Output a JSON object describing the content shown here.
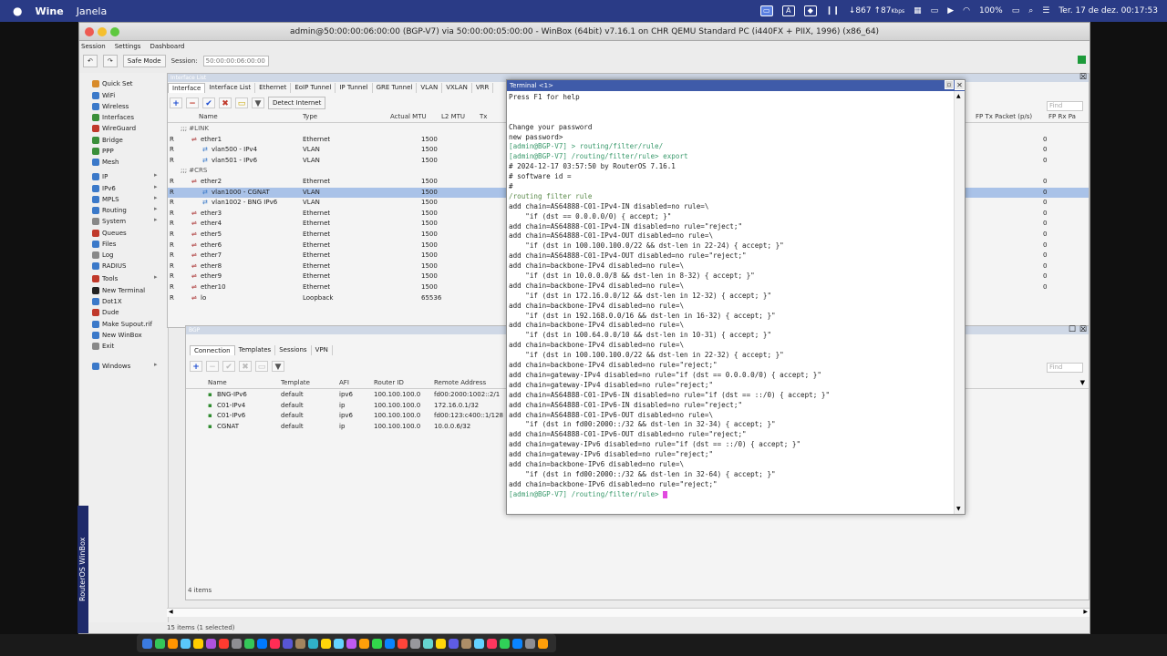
{
  "menubar": {
    "apple": "",
    "app": "Wine",
    "menu_window": "Janela",
    "network": "↓867 ↑87",
    "network_unit": "Kbps",
    "battery": "100%",
    "datetime": "Ter. 17 de dez.  00:17:53"
  },
  "window": {
    "title": "admin@50:00:00:06:00:00 (BGP-V7) via 50:00:00:05:00:00 - WinBox (64bit) v7.16.1 on CHR QEMU Standard PC (i440FX + PIIX, 1996) (x86_64)",
    "menu": [
      "Session",
      "Settings",
      "Dashboard"
    ],
    "safe_mode": "Safe Mode",
    "session_label": "Session:",
    "session_value": "50:00:00:06:00:00"
  },
  "sidebar": {
    "items": [
      {
        "label": "Quick Set",
        "color": "#d88b2a"
      },
      {
        "label": "WiFi",
        "color": "#3b79c9"
      },
      {
        "label": "Wireless",
        "color": "#3b79c9"
      },
      {
        "label": "Interfaces",
        "color": "#3a8f3a"
      },
      {
        "label": "WireGuard",
        "color": "#c0392b"
      },
      {
        "label": "Bridge",
        "color": "#3a8f3a"
      },
      {
        "label": "PPP",
        "color": "#3a8f3a"
      },
      {
        "label": "Mesh",
        "color": "#3b79c9"
      },
      {
        "label": "IP",
        "color": "#3b79c9"
      },
      {
        "label": "IPv6",
        "color": "#3b79c9"
      },
      {
        "label": "MPLS",
        "color": "#3b79c9"
      },
      {
        "label": "Routing",
        "color": "#3b79c9"
      },
      {
        "label": "System",
        "color": "#888888"
      },
      {
        "label": "Queues",
        "color": "#c0392b"
      },
      {
        "label": "Files",
        "color": "#3b79c9"
      },
      {
        "label": "Log",
        "color": "#888888"
      },
      {
        "label": "RADIUS",
        "color": "#3b79c9"
      },
      {
        "label": "Tools",
        "color": "#c0392b"
      },
      {
        "label": "New Terminal",
        "color": "#222222"
      },
      {
        "label": "Dot1X",
        "color": "#3b79c9"
      },
      {
        "label": "Dude",
        "color": "#c0392b"
      },
      {
        "label": "Make Supout.rif",
        "color": "#3b79c9"
      },
      {
        "label": "New WinBox",
        "color": "#3b79c9"
      },
      {
        "label": "Exit",
        "color": "#888888"
      },
      {
        "label": "Windows",
        "color": "#3b79c9"
      }
    ],
    "vertical_label": "RouterOS WinBox"
  },
  "interface_list": {
    "title": "Interface List",
    "tabs": [
      "Interface",
      "Interface List",
      "Ethernet",
      "EoIP Tunnel",
      "IP Tunnel",
      "GRE Tunnel",
      "VLAN",
      "VXLAN",
      "VRR"
    ],
    "detect_internet": "Detect Internet",
    "columns": [
      "Name",
      "Type",
      "Actual MTU",
      "L2 MTU",
      "Tx"
    ],
    "right_columns": [
      "FP Tx Packet (p/s)",
      "FP Rx Pa"
    ],
    "find_placeholder": "Find",
    "rows": [
      {
        "flag": "",
        "name": ";;; #LINK",
        "type": "",
        "mtu": "",
        "right": "",
        "comment": true,
        "indent": 0
      },
      {
        "flag": "R",
        "name": "ether1",
        "type": "Ethernet",
        "mtu": "1500",
        "right": "0",
        "indent": 1
      },
      {
        "flag": "R",
        "name": "vlan500 - IPv4",
        "type": "VLAN",
        "mtu": "1500",
        "right": "0",
        "indent": 2
      },
      {
        "flag": "R",
        "name": "vlan501 - IPv6",
        "type": "VLAN",
        "mtu": "1500",
        "right": "0",
        "indent": 2
      },
      {
        "flag": "",
        "name": ";;; #CRS",
        "type": "",
        "mtu": "",
        "right": "",
        "comment": true,
        "indent": 0
      },
      {
        "flag": "R",
        "name": "ether2",
        "type": "Ethernet",
        "mtu": "1500",
        "right": "0",
        "indent": 1
      },
      {
        "flag": "R",
        "name": "vlan1000 - CGNAT",
        "type": "VLAN",
        "mtu": "1500",
        "right": "0",
        "indent": 2,
        "selected": true
      },
      {
        "flag": "R",
        "name": "vlan1002 - BNG IPv6",
        "type": "VLAN",
        "mtu": "1500",
        "right": "0",
        "indent": 2
      },
      {
        "flag": "R",
        "name": "ether3",
        "type": "Ethernet",
        "mtu": "1500",
        "right": "0",
        "indent": 1
      },
      {
        "flag": "R",
        "name": "ether4",
        "type": "Ethernet",
        "mtu": "1500",
        "right": "0",
        "indent": 1
      },
      {
        "flag": "R",
        "name": "ether5",
        "type": "Ethernet",
        "mtu": "1500",
        "right": "0",
        "indent": 1
      },
      {
        "flag": "R",
        "name": "ether6",
        "type": "Ethernet",
        "mtu": "1500",
        "right": "0",
        "indent": 1
      },
      {
        "flag": "R",
        "name": "ether7",
        "type": "Ethernet",
        "mtu": "1500",
        "right": "0",
        "indent": 1
      },
      {
        "flag": "R",
        "name": "ether8",
        "type": "Ethernet",
        "mtu": "1500",
        "right": "0",
        "indent": 1
      },
      {
        "flag": "R",
        "name": "ether9",
        "type": "Ethernet",
        "mtu": "1500",
        "right": "0",
        "indent": 1
      },
      {
        "flag": "R",
        "name": "ether10",
        "type": "Ethernet",
        "mtu": "1500",
        "right": "0",
        "indent": 1
      },
      {
        "flag": "R",
        "name": "lo",
        "type": "Loopback",
        "mtu": "65536",
        "right": "",
        "indent": 1
      }
    ],
    "status": "15 items (1 selected)"
  },
  "bgp": {
    "title": "BGP",
    "tabs": [
      "Connection",
      "Templates",
      "Sessions",
      "VPN"
    ],
    "columns": [
      "Name",
      "Template",
      "AFI",
      "Router ID",
      "Remote Address"
    ],
    "find_placeholder": "Find",
    "rows": [
      {
        "name": "BNG-IPv6",
        "template": "default",
        "afi": "ipv6",
        "router_id": "100.100.100.0",
        "remote": "fd00:2000:1002::2/1"
      },
      {
        "name": "C01-IPv4",
        "template": "default",
        "afi": "ip",
        "router_id": "100.100.100.0",
        "remote": "172.16.0.1/32"
      },
      {
        "name": "C01-IPv6",
        "template": "default",
        "afi": "ipv6",
        "router_id": "100.100.100.0",
        "remote": "fd00:123:c400::1/128"
      },
      {
        "name": "CGNAT",
        "template": "default",
        "afi": "ip",
        "router_id": "100.100.100.0",
        "remote": "10.0.0.6/32"
      }
    ],
    "status": "4 items"
  },
  "terminal": {
    "title": "Terminal <1>",
    "lines": [
      {
        "t": "Press F1 for help",
        "c": ""
      },
      {
        "t": "",
        "c": ""
      },
      {
        "t": "",
        "c": ""
      },
      {
        "t": "Change your password",
        "c": ""
      },
      {
        "t": "new password>",
        "c": ""
      },
      {
        "t": "[admin@BGP-V7] > routing/filter/rule/",
        "c": "prm"
      },
      {
        "t": "[admin@BGP-V7] /routing/filter/rule> export",
        "c": "prm"
      },
      {
        "t": "# 2024-12-17 03:57:50 by RouterOS 7.16.1",
        "c": ""
      },
      {
        "t": "# software id =",
        "c": ""
      },
      {
        "t": "#",
        "c": ""
      },
      {
        "t": "/routing filter rule",
        "c": "cmt"
      },
      {
        "t": "add chain=AS64888-C01-IPv4-IN disabled=no rule=\\",
        "c": ""
      },
      {
        "t": "    \"if (dst == 0.0.0.0/0) { accept; }\"",
        "c": ""
      },
      {
        "t": "add chain=AS64888-C01-IPv4-IN disabled=no rule=\"reject;\"",
        "c": ""
      },
      {
        "t": "add chain=AS64888-C01-IPv4-OUT disabled=no rule=\\",
        "c": ""
      },
      {
        "t": "    \"if (dst in 100.100.100.0/22 && dst-len in 22-24) { accept; }\"",
        "c": ""
      },
      {
        "t": "add chain=AS64888-C01-IPv4-OUT disabled=no rule=\"reject;\"",
        "c": ""
      },
      {
        "t": "add chain=backbone-IPv4 disabled=no rule=\\",
        "c": ""
      },
      {
        "t": "    \"if (dst in 10.0.0.0/8 && dst-len in 8-32) { accept; }\"",
        "c": ""
      },
      {
        "t": "add chain=backbone-IPv4 disabled=no rule=\\",
        "c": ""
      },
      {
        "t": "    \"if (dst in 172.16.0.0/12 && dst-len in 12-32) { accept; }\"",
        "c": ""
      },
      {
        "t": "add chain=backbone-IPv4 disabled=no rule=\\",
        "c": ""
      },
      {
        "t": "    \"if (dst in 192.168.0.0/16 && dst-len in 16-32) { accept; }\"",
        "c": ""
      },
      {
        "t": "add chain=backbone-IPv4 disabled=no rule=\\",
        "c": ""
      },
      {
        "t": "    \"if (dst in 100.64.0.0/10 && dst-len in 10-31) { accept; }\"",
        "c": ""
      },
      {
        "t": "add chain=backbone-IPv4 disabled=no rule=\\",
        "c": ""
      },
      {
        "t": "    \"if (dst in 100.100.100.0/22 && dst-len in 22-32) { accept; }\"",
        "c": ""
      },
      {
        "t": "add chain=backbone-IPv4 disabled=no rule=\"reject;\"",
        "c": ""
      },
      {
        "t": "add chain=gateway-IPv4 disabled=no rule=\"if (dst == 0.0.0.0/0) { accept; }\"",
        "c": ""
      },
      {
        "t": "add chain=gateway-IPv4 disabled=no rule=\"reject;\"",
        "c": ""
      },
      {
        "t": "add chain=AS64888-C01-IPv6-IN disabled=no rule=\"if (dst == ::/0) { accept; }\"",
        "c": ""
      },
      {
        "t": "add chain=AS64888-C01-IPv6-IN disabled=no rule=\"reject;\"",
        "c": ""
      },
      {
        "t": "add chain=AS64888-C01-IPv6-OUT disabled=no rule=\\",
        "c": ""
      },
      {
        "t": "    \"if (dst in fd00:2000::/32 && dst-len in 32-34) { accept; }\"",
        "c": ""
      },
      {
        "t": "add chain=AS64888-C01-IPv6-OUT disabled=no rule=\"reject;\"",
        "c": ""
      },
      {
        "t": "add chain=gateway-IPv6 disabled=no rule=\"if (dst == ::/0) { accept; }\"",
        "c": ""
      },
      {
        "t": "add chain=gateway-IPv6 disabled=no rule=\"reject;\"",
        "c": ""
      },
      {
        "t": "add chain=backbone-IPv6 disabled=no rule=\\",
        "c": ""
      },
      {
        "t": "    \"if (dst in fd00:2000::/32 && dst-len in 32-64) { accept; }\"",
        "c": ""
      },
      {
        "t": "add chain=backbone-IPv6 disabled=no rule=\"reject;\"",
        "c": ""
      }
    ],
    "prompt": "[admin@BGP-V7] /routing/filter/rule> "
  }
}
